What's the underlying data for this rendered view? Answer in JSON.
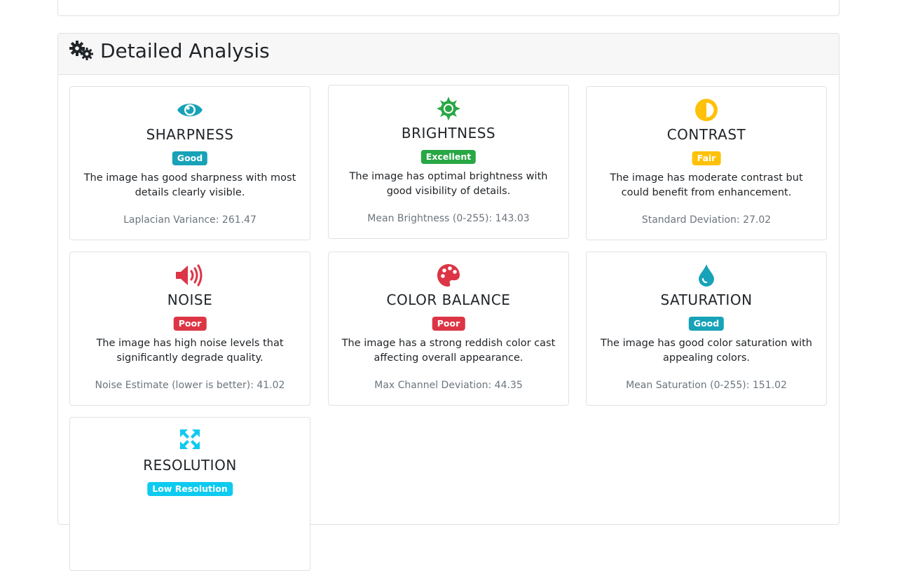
{
  "section": {
    "title": "Detailed Analysis",
    "icon": "gears-icon"
  },
  "colors": {
    "good": "#17a2b8",
    "excellent": "#28a745",
    "fair": "#ffc107",
    "poor": "#dc3545",
    "low_resolution": "#0dcaf0"
  },
  "cards": [
    {
      "key": "sharpness",
      "icon": "eye-icon",
      "title": "SHARPNESS",
      "badge": "Good",
      "description": "The image has good sharpness with most details clearly visible.",
      "metric": "Laplacian Variance: 261.47"
    },
    {
      "key": "brightness",
      "icon": "sun-icon",
      "title": "BRIGHTNESS",
      "badge": "Excellent",
      "description": "The image has optimal brightness with good visibility of details.",
      "metric": "Mean Brightness (0-255): 143.03"
    },
    {
      "key": "contrast",
      "icon": "adjust-icon",
      "title": "CONTRAST",
      "badge": "Fair",
      "description": "The image has moderate contrast but could benefit from enhancement.",
      "metric": "Standard Deviation: 27.02"
    },
    {
      "key": "noise",
      "icon": "volume-up-icon",
      "title": "NOISE",
      "badge": "Poor",
      "description": "The image has high noise levels that significantly degrade quality.",
      "metric": "Noise Estimate (lower is better): 41.02"
    },
    {
      "key": "color-balance",
      "icon": "palette-icon",
      "title": "COLOR BALANCE",
      "badge": "Poor",
      "description": "The image has a strong reddish color cast affecting overall appearance.",
      "metric": "Max Channel Deviation: 44.35"
    },
    {
      "key": "saturation",
      "icon": "tint-icon",
      "title": "SATURATION",
      "badge": "Good",
      "description": "The image has good color saturation with appealing colors.",
      "metric": "Mean Saturation (0-255): 151.02"
    },
    {
      "key": "resolution",
      "icon": "expand-arrows-icon",
      "title": "RESOLUTION",
      "badge": "Low Resolution",
      "description": "",
      "metric": ""
    }
  ]
}
